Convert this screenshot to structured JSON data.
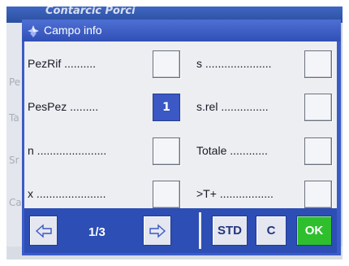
{
  "background_app": {
    "title": "Contarcic Porci",
    "left_items": [
      "Pe",
      "Ta",
      "Sr",
      "Ca"
    ]
  },
  "dialog": {
    "title": "Campo info",
    "icon": "balance-scale-icon",
    "left_column": [
      {
        "label": "PezRif ..........",
        "value": "",
        "active": false
      },
      {
        "label": "PesPez .........",
        "value": "1",
        "active": true
      },
      {
        "label": "n ......................",
        "value": "",
        "active": false
      },
      {
        "label": "x ......................",
        "value": "",
        "active": false
      }
    ],
    "right_column": [
      {
        "label": "s .....................",
        "value": "",
        "active": false
      },
      {
        "label": "s.rel ...............",
        "value": "",
        "active": false
      },
      {
        "label": "Totale ............",
        "value": "",
        "active": false
      },
      {
        "label": ">T+ .................",
        "value": "",
        "active": false
      }
    ],
    "footer": {
      "prev_icon": "arrow-left-icon",
      "page": "1/3",
      "next_icon": "arrow-right-icon",
      "std_label": "STD",
      "c_label": "C",
      "ok_label": "OK"
    }
  },
  "colors": {
    "dialog_frame": "#3a5cc8",
    "active_box": "#3b58c4",
    "ok_button": "#2fbf2d"
  }
}
